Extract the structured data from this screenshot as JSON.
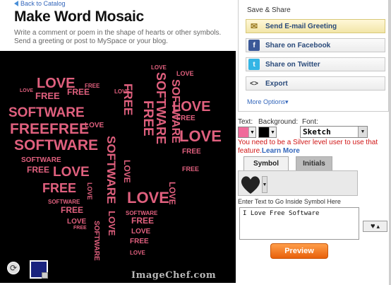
{
  "nav": {
    "back_label": "Back to Catalog"
  },
  "header": {
    "title": "Make Word Mosaic",
    "subtitle": "Write a comment or poem in the shape of hearts or other symbols. Send a greeting or post to MySpace or your blog."
  },
  "canvas": {
    "background": "#000000",
    "text_color": "#e0607e",
    "words": [
      "LOVE",
      "FREE",
      "SOFTWARE"
    ],
    "watermark": "ImageChef.com",
    "background_chip_color": "#1a237e"
  },
  "share": {
    "title": "Save & Share",
    "buttons": [
      {
        "label": "Send E-mail Greeting",
        "icon": "envelope-icon"
      },
      {
        "label": "Share on Facebook",
        "icon": "facebook-icon"
      },
      {
        "label": "Share on Twitter",
        "icon": "twitter-icon"
      },
      {
        "label": "Export",
        "icon": "code-icon"
      }
    ],
    "more_options": "More Options"
  },
  "controls": {
    "text_label": "Text:",
    "background_label": "Background:",
    "font_label": "Font:",
    "text_color": "#f06a9a",
    "background_color": "#000000",
    "font_value": "Sketch",
    "warning": "You need to be a Silver level user to use that feature.",
    "learn_more": "Learn More"
  },
  "tabs": [
    {
      "label": "Symbol",
      "active": true
    },
    {
      "label": "Initials",
      "active": false
    }
  ],
  "symbol": {
    "selected_icon": "heart-icon"
  },
  "text_input": {
    "label": "Enter Text to Go Inside Symbol Here",
    "value": "I Love Free Software"
  },
  "preview_label": "Preview"
}
